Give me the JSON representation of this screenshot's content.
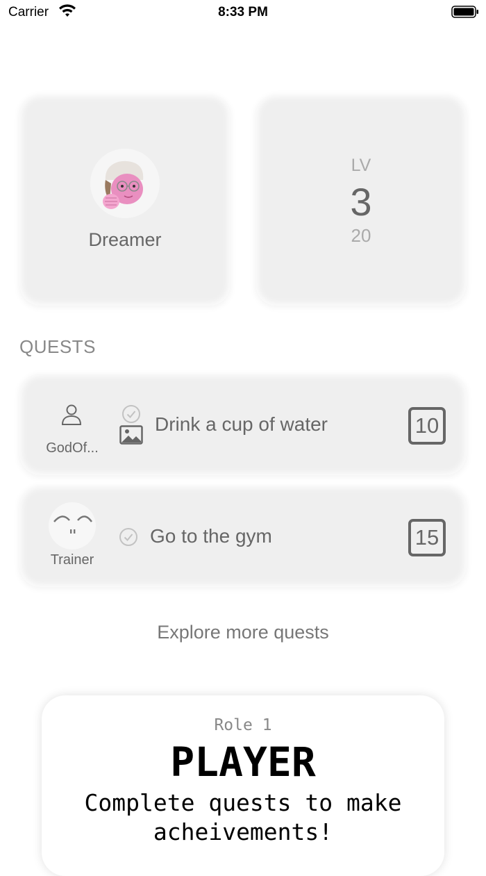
{
  "status_bar": {
    "carrier": "Carrier",
    "time": "8:33 PM"
  },
  "profile": {
    "name": "Dreamer"
  },
  "level": {
    "label": "LV",
    "value": "3",
    "sub": "20"
  },
  "quests_section": {
    "title": "QUESTS"
  },
  "quests": [
    {
      "issuer": "GodOf...",
      "title": "Drink a cup of water",
      "points": "10"
    },
    {
      "issuer": "Trainer",
      "title": "Go to the gym",
      "points": "15"
    }
  ],
  "explore": {
    "label": "Explore more quests"
  },
  "role": {
    "label": "Role 1",
    "name": "PLAYER",
    "description": "Complete quests to make acheivements!"
  }
}
